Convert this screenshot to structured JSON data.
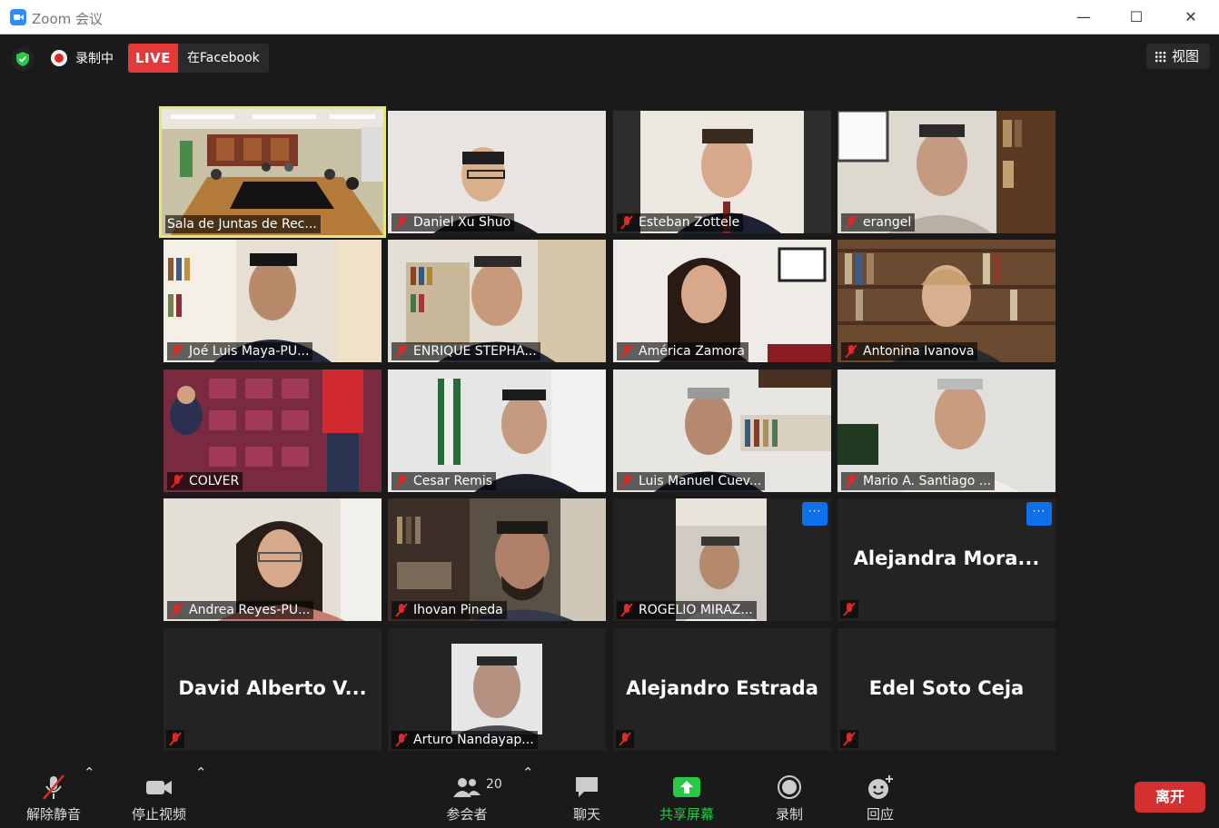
{
  "window": {
    "title": "Zoom 会议"
  },
  "status_bar": {
    "recording_label": "录制中",
    "live_badge": "LIVE",
    "live_target": "在Facebook",
    "view_label": "视图"
  },
  "participants": [
    {
      "name": "Sala de Juntas de Rec...",
      "muted": false,
      "active": true
    },
    {
      "name": "Daniel Xu Shuo",
      "muted": true
    },
    {
      "name": "Esteban Zottele",
      "muted": true
    },
    {
      "name": "erangel",
      "muted": true
    },
    {
      "name": "Joé Luis Maya-PU...",
      "muted": true
    },
    {
      "name": "ENRIQUE STEPHA...",
      "muted": true
    },
    {
      "name": "América Zamora",
      "muted": true
    },
    {
      "name": "Antonina Ivanova",
      "muted": true
    },
    {
      "name": "COLVER",
      "muted": true
    },
    {
      "name": "Cesar Remis",
      "muted": true
    },
    {
      "name": "Luis Manuel Cuev...",
      "muted": true
    },
    {
      "name": "Mario A. Santiago ...",
      "muted": true
    },
    {
      "name": "Andrea Reyes-PU...",
      "muted": true
    },
    {
      "name": "Ihovan Pineda",
      "muted": true
    },
    {
      "name": "ROGELIO MIRAZ...",
      "muted": true,
      "more_menu": "···"
    },
    {
      "name": "Alejandra  Mora...",
      "muted": true,
      "video_off": true,
      "more_menu": "···"
    },
    {
      "name": "David Alberto V...",
      "muted": true,
      "video_off": true
    },
    {
      "name": "Arturo Nandayap...",
      "muted": true
    },
    {
      "name": "Alejandro Estrada",
      "muted": true,
      "video_off": true
    },
    {
      "name": "Edel Soto Ceja",
      "muted": true,
      "video_off": true
    }
  ],
  "toolbar": {
    "unmute_label": "解除静音",
    "stop_video_label": "停止视频",
    "participants_label": "参会者",
    "participants_count": "20",
    "chat_label": "聊天",
    "share_label": "共享屏幕",
    "record_label": "录制",
    "reactions_label": "回应",
    "leave_label": "离开"
  },
  "colors": {
    "accent_share": "#27c947",
    "leave": "#d3302f",
    "live": "#e53838",
    "active_speaker": "#e6e676",
    "more_button": "#0e71eb"
  }
}
